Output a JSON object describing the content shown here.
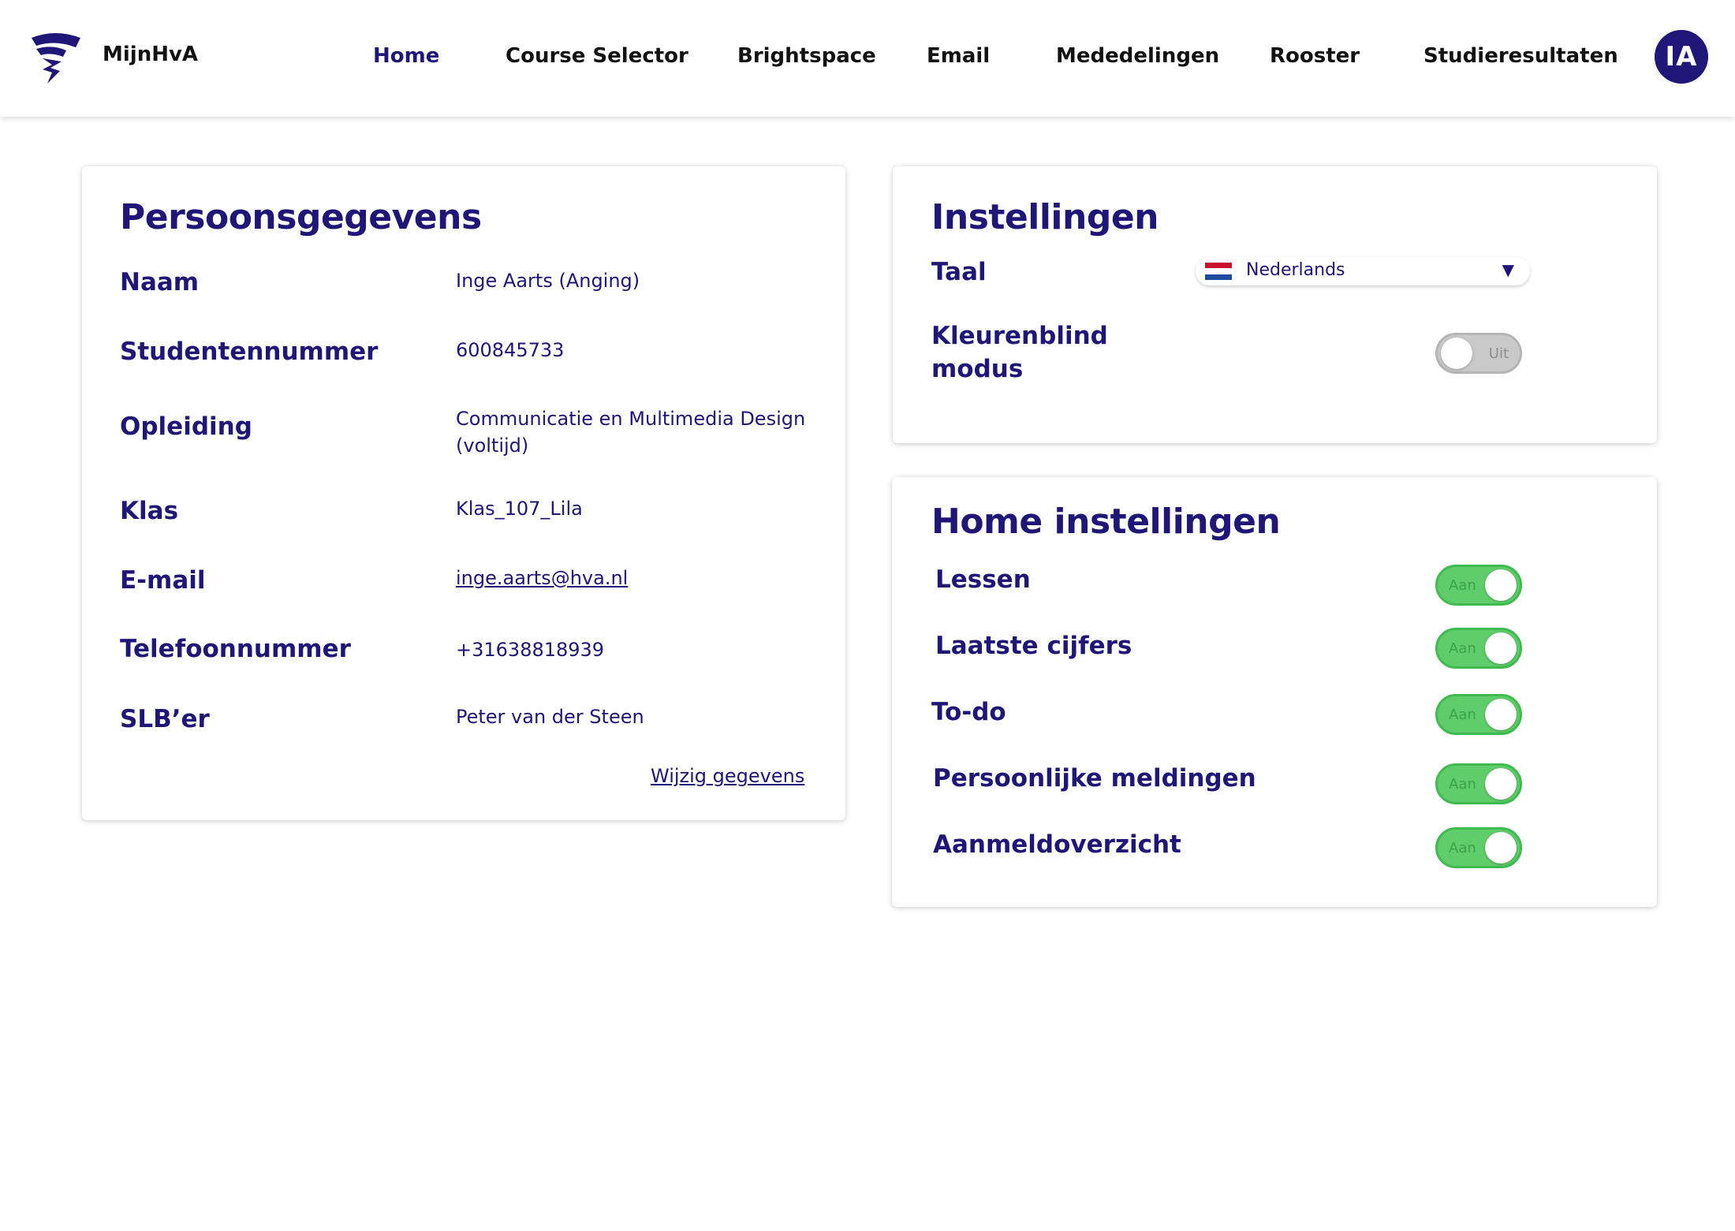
{
  "header": {
    "brand": "MijnHvA",
    "nav": [
      "Home",
      "Course Selector",
      "Brightspace",
      "Email",
      "Mededelingen",
      "Rooster",
      "Studieresultaten"
    ],
    "active_nav": "Home",
    "avatar_initials": "IA",
    "accent_color": "#1f1677"
  },
  "personal": {
    "title": "Persoonsgegevens",
    "fields": [
      {
        "label": "Naam",
        "value": "Inge Aarts  (Anging)"
      },
      {
        "label": "Studentennummer",
        "value": "600845733"
      },
      {
        "label": "Opleiding",
        "value": "Communicatie en Multimedia Design (voltijd)"
      },
      {
        "label": "Klas",
        "value": "Klas_107_Lila"
      },
      {
        "label": "E-mail",
        "value": "inge.aarts@hva.nl"
      },
      {
        "label": "Telefoonnummer",
        "value": "+31638818939"
      },
      {
        "label": "SLB’er",
        "value": "Peter van der Steen"
      }
    ],
    "edit_link": "Wijzig gegevens"
  },
  "settings": {
    "title": "Instellingen",
    "language_label": "Taal",
    "language_value": "Nederlands",
    "language_flag_icon": "netherlands-flag-icon",
    "colorblind_label_line1": "Kleurenblind",
    "colorblind_label_line2": "modus",
    "colorblind_toggle": "Uit"
  },
  "home_settings": {
    "title": "Home instellingen",
    "items": [
      {
        "label": "Lessen",
        "state": "Aan"
      },
      {
        "label": "Laatste cijfers",
        "state": "Aan"
      },
      {
        "label": "To-do",
        "state": "Aan"
      },
      {
        "label": "Persoonlijke meldingen",
        "state": "Aan"
      },
      {
        "label": "Aanmeldoverzicht",
        "state": "Aan"
      }
    ],
    "on_color": "#5fcd6a",
    "off_color": "#c9c9c9"
  }
}
